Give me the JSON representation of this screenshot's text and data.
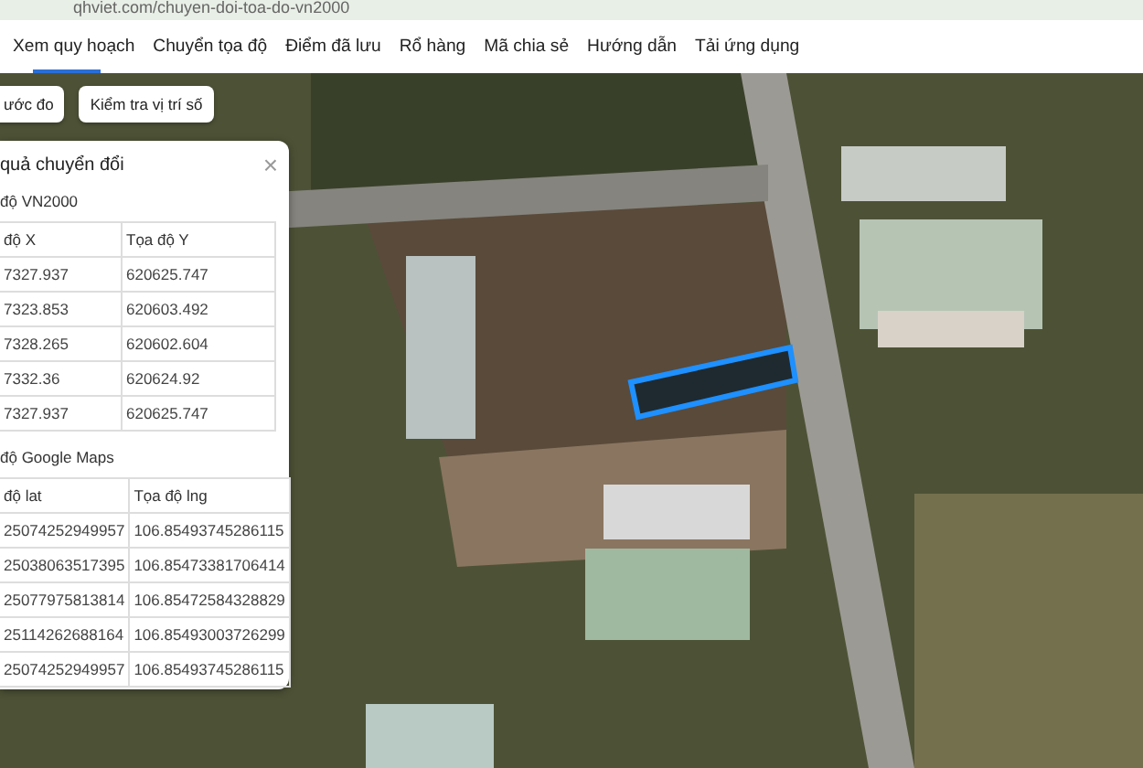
{
  "address_bar": {
    "url": "qhviet.com/chuyen-doi-toa-do-vn2000"
  },
  "nav": [
    {
      "label": "Xem quy hoạch",
      "selected": true
    },
    {
      "label": "Chuyển tọa độ",
      "selected": false
    },
    {
      "label": "Điểm đã lưu",
      "selected": false
    },
    {
      "label": "Rổ hàng",
      "selected": false
    },
    {
      "label": "Mã chia sẻ",
      "selected": false
    },
    {
      "label": "Hướng dẫn",
      "selected": false
    },
    {
      "label": "Tải ứng dụng",
      "selected": false
    }
  ],
  "map_buttons": [
    "ước đo",
    "Kiểm tra vị trí số"
  ],
  "panel": {
    "title": "quả chuyển đổi",
    "close": "×",
    "sections": [
      {
        "heading": "độ VN2000",
        "columns": [
          "độ X",
          "Tọa độ Y"
        ],
        "rows": [
          [
            "7327.937",
            "620625.747"
          ],
          [
            "7323.853",
            "620603.492"
          ],
          [
            "7328.265",
            "620602.604"
          ],
          [
            "7332.36",
            "620624.92"
          ],
          [
            "7327.937",
            "620625.747"
          ]
        ]
      },
      {
        "heading": "độ Google Maps",
        "columns": [
          "độ lat",
          "Tọa độ lng"
        ],
        "rows": [
          [
            "25074252949957",
            "106.85493745286115"
          ],
          [
            "25038063517395",
            "106.85473381706414"
          ],
          [
            "25077975813814",
            "106.85472584328829"
          ],
          [
            "25114262688164",
            "106.85493003726299"
          ],
          [
            "25074252949957",
            "106.85493745286115"
          ]
        ]
      }
    ]
  }
}
